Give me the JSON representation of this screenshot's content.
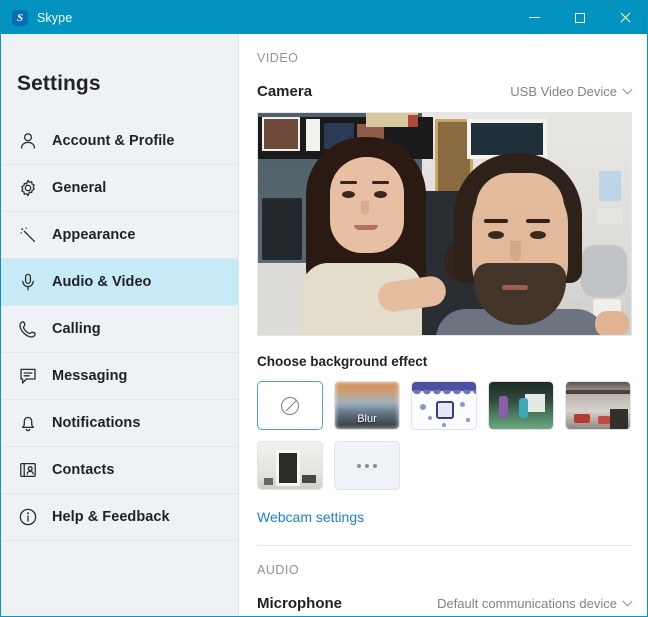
{
  "window": {
    "title": "Skype",
    "logo_letter": "S",
    "accent_color": "#0093bf",
    "controls": {
      "minimize": "minimize-button",
      "maximize": "maximize-button",
      "close": "close-button"
    }
  },
  "sidebar": {
    "heading": "Settings",
    "active_index": 3,
    "items": [
      {
        "label": "Account & Profile",
        "icon": "person-icon"
      },
      {
        "label": "General",
        "icon": "gear-icon"
      },
      {
        "label": "Appearance",
        "icon": "magic-wand-icon"
      },
      {
        "label": "Audio & Video",
        "icon": "microphone-icon"
      },
      {
        "label": "Calling",
        "icon": "phone-icon"
      },
      {
        "label": "Messaging",
        "icon": "chat-bubble-icon"
      },
      {
        "label": "Notifications",
        "icon": "bell-icon"
      },
      {
        "label": "Contacts",
        "icon": "contact-card-icon"
      },
      {
        "label": "Help & Feedback",
        "icon": "info-icon"
      }
    ]
  },
  "content": {
    "video_section": {
      "header": "VIDEO",
      "camera_label": "Camera",
      "camera_value": "USB Video Device",
      "background_effect_title": "Choose background effect",
      "webcam_settings_link": "Webcam settings",
      "effects": [
        {
          "name": "none",
          "label": "",
          "selected": true
        },
        {
          "name": "blur",
          "label": "Blur",
          "selected": false
        },
        {
          "name": "pattern",
          "label": "",
          "selected": false
        },
        {
          "name": "scene",
          "label": "",
          "selected": false
        },
        {
          "name": "loft",
          "label": "",
          "selected": false
        },
        {
          "name": "room",
          "label": "",
          "selected": false
        },
        {
          "name": "more",
          "label": "",
          "selected": false
        }
      ]
    },
    "audio_section": {
      "header": "AUDIO",
      "microphone_label": "Microphone",
      "microphone_value": "Default communications device"
    }
  },
  "colors": {
    "titlebar": "#0093bf",
    "sidebar_bg": "#eef2f5",
    "active_item": "#c7eaf7",
    "link": "#1a7fd4",
    "selected_border": "#4ea3dd"
  }
}
